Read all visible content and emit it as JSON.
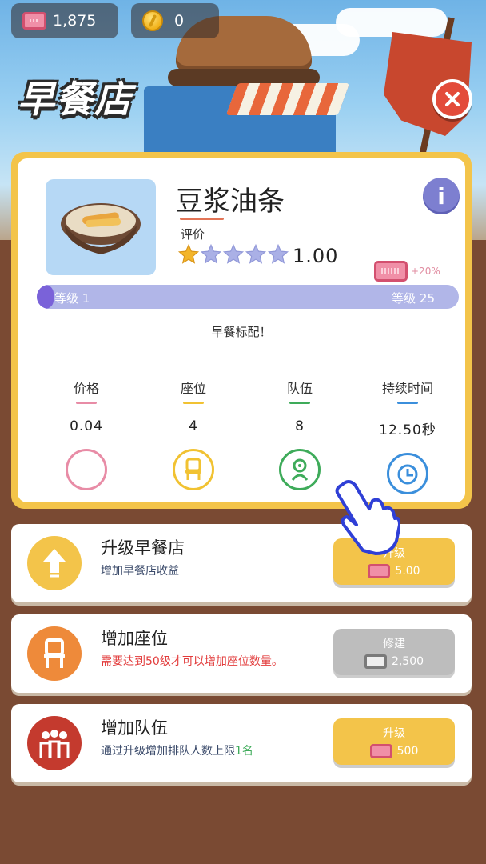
{
  "resources": {
    "tickets": "1,875",
    "coins": "0"
  },
  "shop_title": "早餐店",
  "dish": {
    "name": "豆浆油条",
    "rating_label": "评价",
    "rating_value": "1.00",
    "stars_filled": 1,
    "stars_total": 5,
    "bonus": "+20%",
    "level_start_label": "等级 1",
    "level_end_label": "等级 25",
    "level_progress": 0.04,
    "description": "早餐标配！"
  },
  "stats": [
    {
      "label": "价格",
      "value": "0.04",
      "color": "#e88ca6",
      "icon": "price-icon"
    },
    {
      "label": "座位",
      "value": "4",
      "color": "#f1c232",
      "icon": "chair-icon"
    },
    {
      "label": "队伍",
      "value": "8",
      "color": "#3eab5a",
      "icon": "person-icon"
    },
    {
      "label": "持续时间",
      "value": "12.50秒",
      "color": "#3b8fdc",
      "icon": "clock-icon"
    }
  ],
  "upgrades": [
    {
      "title": "升级早餐店",
      "subtitle": "增加早餐店收益",
      "button": "升级",
      "cost": "5.00",
      "enabled": true,
      "icon": "arrow-up-icon",
      "icon_color": "#f3c44a"
    },
    {
      "title": "增加座位",
      "subtitle": "需要达到50级才可以增加座位数量。",
      "button": "修建",
      "cost": "2,500",
      "enabled": false,
      "icon": "chair-icon",
      "icon_color": "#ee8a3a"
    },
    {
      "title": "增加队伍",
      "subtitle_prefix": "通过升级增加排队人数上限",
      "subtitle_highlight": "1名",
      "button": "升级",
      "cost": "500",
      "enabled": true,
      "icon": "people-icon",
      "icon_color": "#c43a2e"
    }
  ],
  "colors": {
    "panel_border": "#f3c44a",
    "button_yellow": "#f3c44a",
    "button_gray": "#bdbdbd",
    "level_fill": "#7a62d9",
    "level_track": "#b1b6e8",
    "warning_text": "#e23b3b",
    "highlight_text": "#3eab5a"
  }
}
